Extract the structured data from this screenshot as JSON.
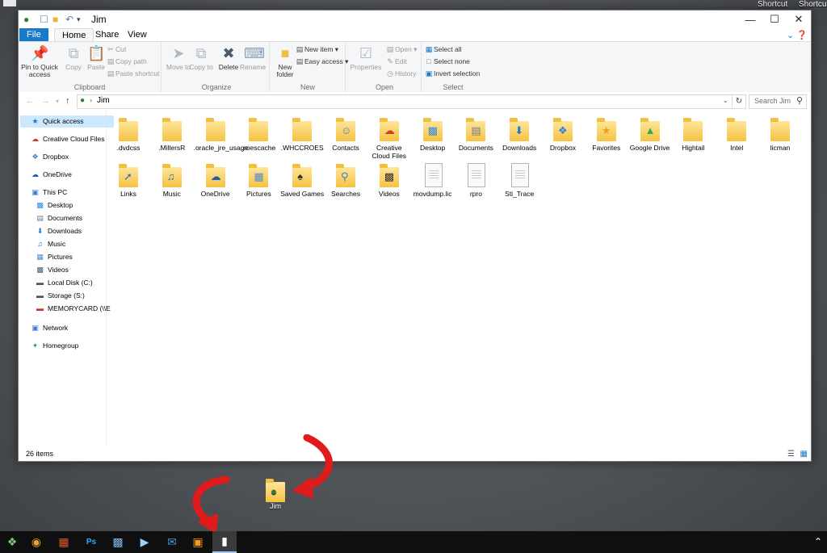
{
  "desktop": {
    "shortcut_labels": [
      "Shortcut",
      "Shortcut"
    ],
    "jim_shortcut_label": "Jim"
  },
  "window": {
    "title": "Jim",
    "tabs": [
      "File",
      "Home",
      "Share",
      "View"
    ],
    "ribbon": {
      "clipboard": {
        "label": "Clipboard",
        "pin": "Pin to Quick access",
        "copy": "Copy",
        "paste": "Paste",
        "cut": "Cut",
        "copy_path": "Copy path",
        "paste_shortcut": "Paste shortcut"
      },
      "organize": {
        "label": "Organize",
        "move_to": "Move to",
        "copy_to": "Copy to",
        "delete": "Delete",
        "rename": "Rename"
      },
      "new": {
        "label": "New",
        "new_folder": "New folder",
        "new_item": "New item",
        "easy_access": "Easy access"
      },
      "open": {
        "label": "Open",
        "properties": "Properties",
        "open": "Open",
        "edit": "Edit",
        "history": "History"
      },
      "select": {
        "label": "Select",
        "select_all": "Select all",
        "select_none": "Select none",
        "invert_selection": "Invert selection"
      }
    },
    "address": {
      "path": "Jim",
      "search_placeholder": "Search Jim"
    },
    "nav": [
      {
        "label": "Quick access",
        "icon": "star-icon"
      },
      {
        "label": "Creative Cloud Files",
        "icon": "creative-cloud-icon"
      },
      {
        "label": "Dropbox",
        "icon": "dropbox-icon"
      },
      {
        "label": "OneDrive",
        "icon": "onedrive-icon"
      },
      {
        "label": "This PC",
        "icon": "computer-icon"
      },
      {
        "label": "Desktop",
        "icon": "desktop-icon"
      },
      {
        "label": "Documents",
        "icon": "documents-icon"
      },
      {
        "label": "Downloads",
        "icon": "downloads-icon"
      },
      {
        "label": "Music",
        "icon": "music-icon"
      },
      {
        "label": "Pictures",
        "icon": "pictures-icon"
      },
      {
        "label": "Videos",
        "icon": "videos-icon"
      },
      {
        "label": "Local Disk (C:)",
        "icon": "drive-icon"
      },
      {
        "label": "Storage (S:)",
        "icon": "drive-icon"
      },
      {
        "label": "MEMORYCARD (\\\\E",
        "icon": "network-drive-icon"
      },
      {
        "label": "Network",
        "icon": "network-icon"
      },
      {
        "label": "Homegroup",
        "icon": "homegroup-icon"
      }
    ],
    "files": [
      {
        "label": ".dvdcss",
        "type": "folder"
      },
      {
        "label": ".MillersR",
        "type": "folder"
      },
      {
        "label": ".oracle_jre_usage",
        "type": "folder"
      },
      {
        "label": ".roescache",
        "type": "folder"
      },
      {
        "label": ".WHCCROES",
        "type": "folder"
      },
      {
        "label": "Contacts",
        "type": "folder"
      },
      {
        "label": "Creative Cloud Files",
        "type": "folder"
      },
      {
        "label": "Desktop",
        "type": "folder"
      },
      {
        "label": "Documents",
        "type": "folder"
      },
      {
        "label": "Downloads",
        "type": "folder"
      },
      {
        "label": "Dropbox",
        "type": "folder"
      },
      {
        "label": "Favorites",
        "type": "folder"
      },
      {
        "label": "Google Drive",
        "type": "folder"
      },
      {
        "label": "Hightail",
        "type": "folder"
      },
      {
        "label": "Intel",
        "type": "folder"
      },
      {
        "label": "licman",
        "type": "folder"
      },
      {
        "label": "Links",
        "type": "folder"
      },
      {
        "label": "Music",
        "type": "folder"
      },
      {
        "label": "OneDrive",
        "type": "folder"
      },
      {
        "label": "Pictures",
        "type": "folder"
      },
      {
        "label": "Saved Games",
        "type": "folder"
      },
      {
        "label": "Searches",
        "type": "folder"
      },
      {
        "label": "Videos",
        "type": "folder"
      },
      {
        "label": "movdump.lic",
        "type": "file"
      },
      {
        "label": "rpro",
        "type": "file"
      },
      {
        "label": "Sti_Trace",
        "type": "file"
      }
    ],
    "status": "26 items"
  },
  "colors": {
    "accent": "#1979ca",
    "selection": "#cce8ff",
    "arrow": "#e01b1b"
  }
}
